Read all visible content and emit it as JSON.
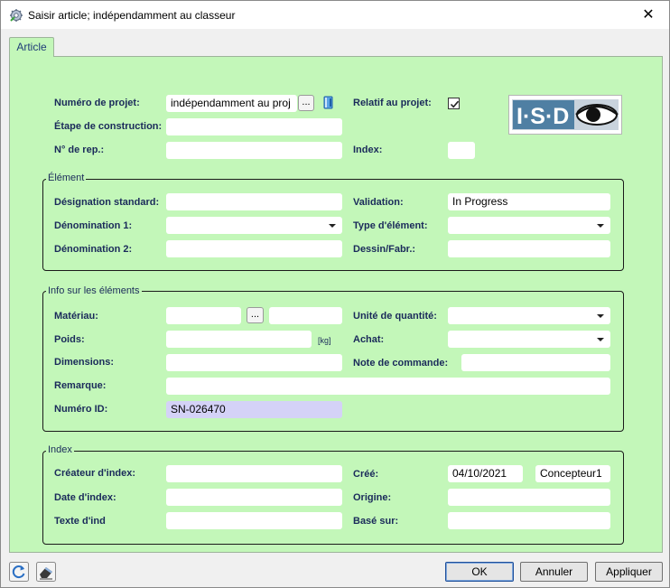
{
  "window": {
    "title": "Saisir article; indépendamment au classeur",
    "close_glyph": "✕"
  },
  "tabs": [
    {
      "label": "Article"
    }
  ],
  "project": {
    "numero_projet_label": "Numéro de projet:",
    "numero_projet_value": "indépendamment au proj",
    "browse_label": "...",
    "relatif_label": "Relatif au projet:",
    "relatif_checked": true,
    "etape_label": "Étape de construction:",
    "etape_value": "",
    "rep_label": "N° de rep.:",
    "rep_value": "",
    "index_label": "Index:",
    "index_value": ""
  },
  "element": {
    "title": "Élément",
    "designation_label": "Désignation standard:",
    "designation_value": "",
    "denom1_label": "Dénomination 1:",
    "denom1_value": "",
    "denom2_label": "Dénomination 2:",
    "denom2_value": "",
    "validation_label": "Validation:",
    "validation_value": "In Progress",
    "type_label": "Type d'élément:",
    "type_value": "",
    "dessin_label": "Dessin/Fabr.:",
    "dessin_value": ""
  },
  "info": {
    "title": "Info sur les éléments",
    "materiau_label": "Matériau:",
    "materiau_value": "",
    "materiau_browse": "...",
    "materiau_value2": "",
    "poids_label": "Poids:",
    "poids_value": "",
    "poids_unit": "[kg]",
    "dimensions_label": "Dimensions:",
    "dimensions_value": "",
    "remarque_label": "Remarque:",
    "remarque_value": "",
    "numero_id_label": "Numéro ID:",
    "numero_id_value": "SN-026470",
    "unite_label": "Unité de quantité:",
    "unite_value": "",
    "achat_label": "Achat:",
    "achat_value": "",
    "note_label": "Note de commande:",
    "note_value": ""
  },
  "index_group": {
    "title": "Index",
    "createur_label": "Créateur d'index:",
    "createur_value": "",
    "date_label": "Date d'index:",
    "date_value": "",
    "texte_label": "Texte d'ind",
    "texte_value": "",
    "cree_label": "Créé:",
    "cree_date": "04/10/2021",
    "cree_user": "Concepteur1",
    "origine_label": "Origine:",
    "origine_value": "",
    "base_label": "Basé sur:",
    "base_value": ""
  },
  "logo": {
    "text": "I·S·D"
  },
  "footer": {
    "ok_label": "OK",
    "annuler_label": "Annuler",
    "appliquer_label": "Appliquer"
  },
  "colors": {
    "panel": "#c3f7b9",
    "label": "#1a2a5a",
    "id_field": "#d4d2f7"
  }
}
